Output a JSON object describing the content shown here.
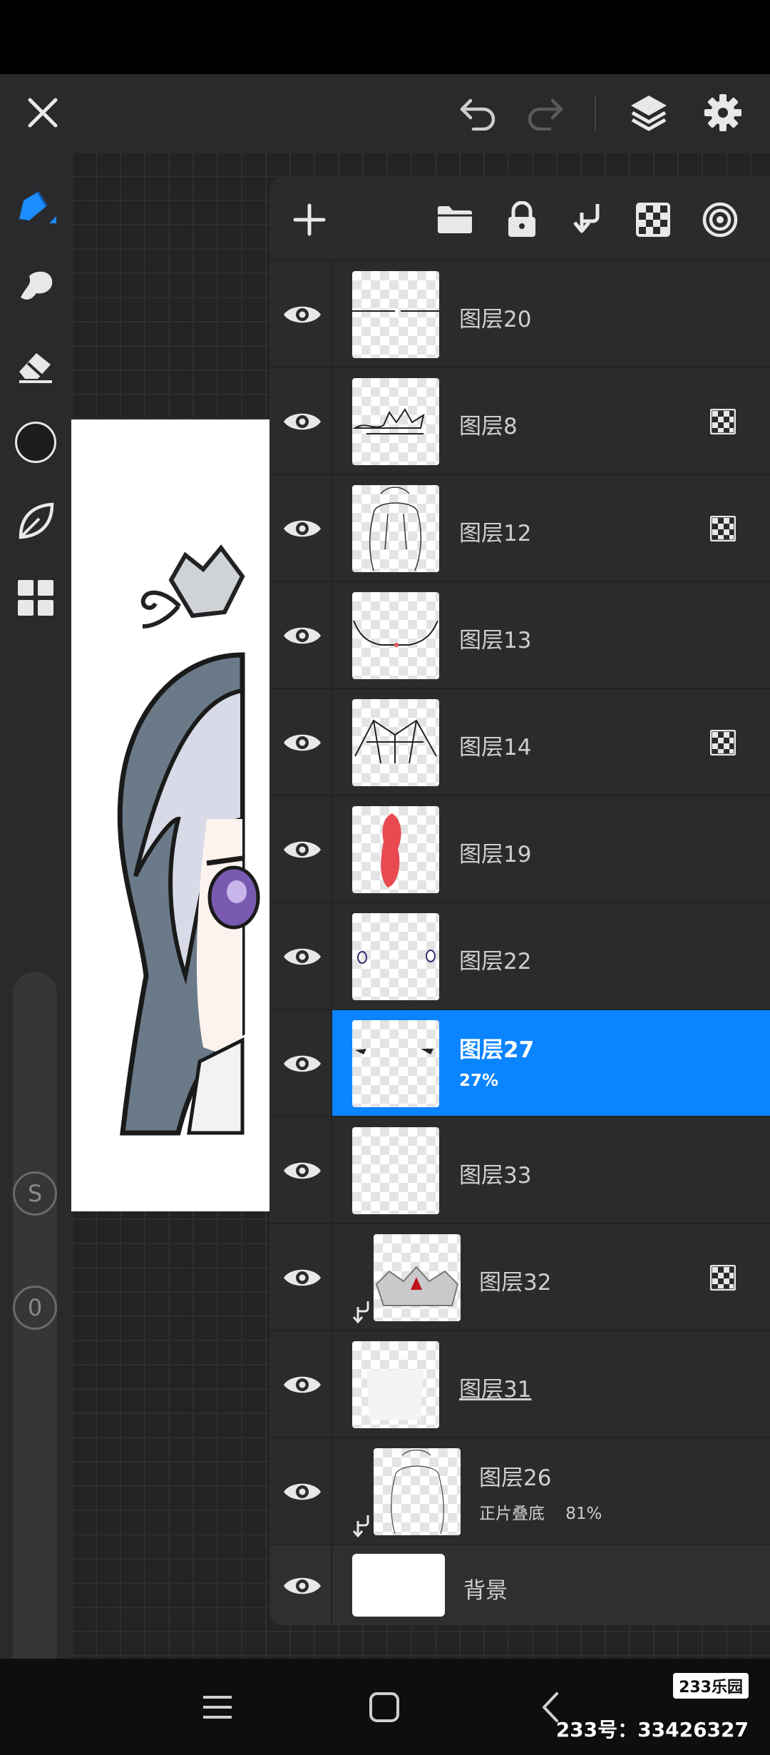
{
  "app": {
    "accent_color": "#0a84ff",
    "panel_color": "#2b2b2d"
  },
  "toolbar": {
    "close": "close-icon",
    "undo": "undo-icon",
    "redo": "redo-icon",
    "layers": "layers-icon",
    "settings": "gear-icon"
  },
  "left_tools": {
    "items": [
      "pen-icon",
      "smudge-icon",
      "eraser-icon",
      "color-swatch",
      "leaf-icon",
      "grid-icon"
    ],
    "brush_size_label": "S",
    "opacity_label": "0",
    "current_color": "#1c1c1c"
  },
  "layers_panel": {
    "toolbar_icons": [
      "add-icon",
      "folder-icon",
      "lock-icon",
      "merge-down-icon",
      "alpha-lock-icon",
      "target-icon"
    ],
    "layers": [
      {
        "name": "图层20",
        "sub": "",
        "alpha_lock": false,
        "clipped": false,
        "selected": false
      },
      {
        "name": "图层8",
        "sub": "",
        "alpha_lock": true,
        "clipped": false,
        "selected": false
      },
      {
        "name": "图层12",
        "sub": "",
        "alpha_lock": true,
        "clipped": false,
        "selected": false
      },
      {
        "name": "图层13",
        "sub": "",
        "alpha_lock": false,
        "clipped": false,
        "selected": false
      },
      {
        "name": "图层14",
        "sub": "",
        "alpha_lock": true,
        "clipped": false,
        "selected": false
      },
      {
        "name": "图层19",
        "sub": "",
        "alpha_lock": false,
        "clipped": false,
        "selected": false
      },
      {
        "name": "图层22",
        "sub": "",
        "alpha_lock": false,
        "clipped": false,
        "selected": false
      },
      {
        "name": "图层27",
        "sub": "27%",
        "alpha_lock": false,
        "clipped": false,
        "selected": true
      },
      {
        "name": "图层33",
        "sub": "",
        "alpha_lock": false,
        "clipped": false,
        "selected": false
      },
      {
        "name": "图层32",
        "sub": "",
        "alpha_lock": true,
        "clipped": true,
        "selected": false
      },
      {
        "name": "图层31",
        "sub": "",
        "alpha_lock": false,
        "clipped": false,
        "selected": false
      },
      {
        "name": "图层26",
        "sub": "正片叠底    81%",
        "alpha_lock": false,
        "clipped": true,
        "selected": false
      }
    ],
    "background_layer": {
      "name": "背景"
    }
  },
  "navbar": {
    "menu": "menu-icon",
    "home": "home-icon",
    "back": "back-icon"
  },
  "watermark": {
    "logo": "233乐园",
    "text": "233号：33426327"
  }
}
